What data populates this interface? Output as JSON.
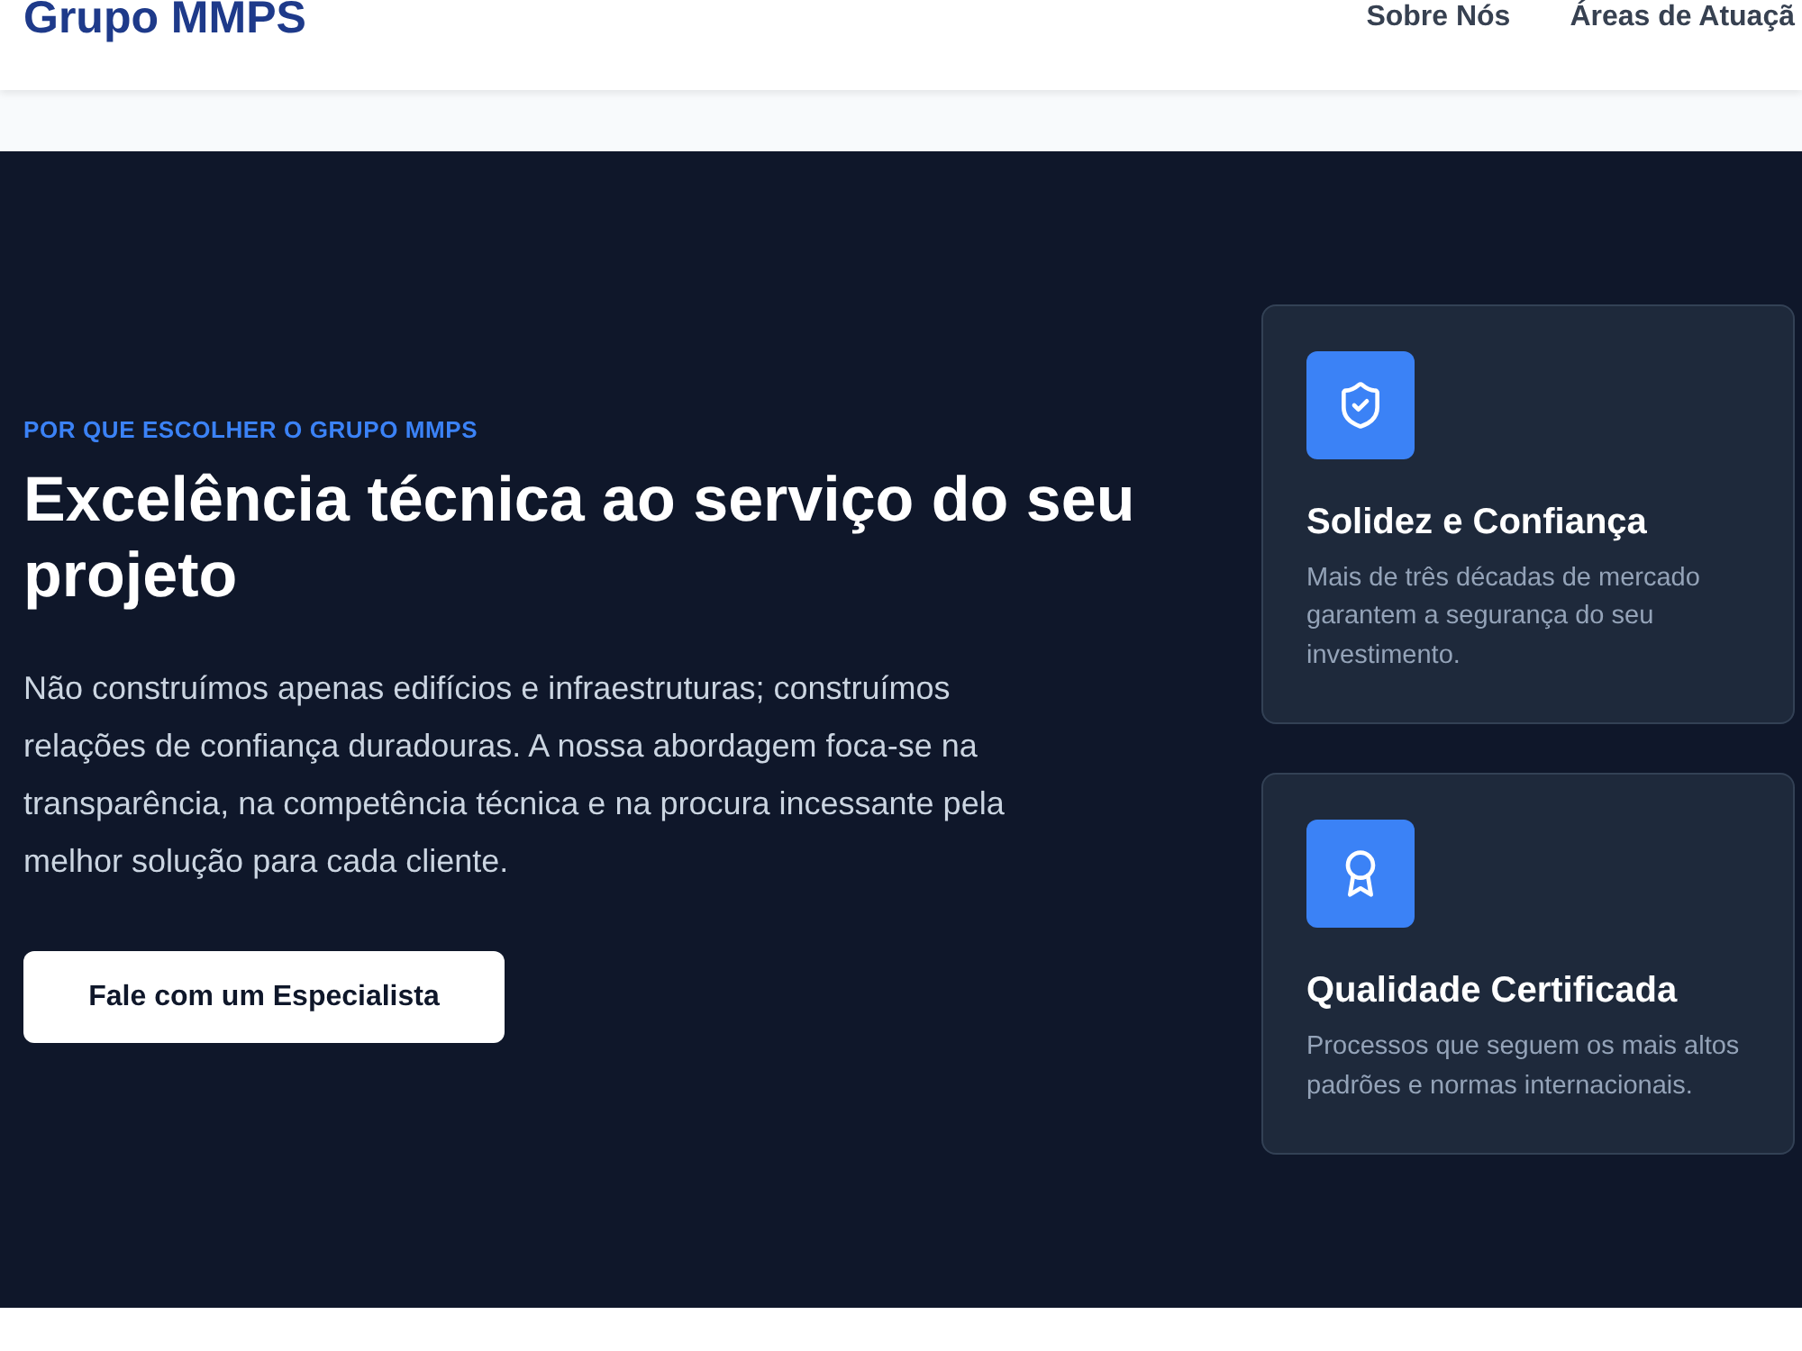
{
  "header": {
    "logo": "Grupo MMPS",
    "nav": [
      "Sobre Nós",
      "Áreas de Atuaçã"
    ]
  },
  "hero": {
    "eyebrow": "POR QUE ESCOLHER O GRUPO MMPS",
    "title": "Excelência técnica ao serviço do seu projeto",
    "paragraph": "Não construímos apenas edifícios e infraestruturas; construímos relações de confiança duradouras. A nossa abordagem foca-se na transparência, na competência técnica e na procura incessante pela melhor solução para cada cliente.",
    "button": "Fale com um Especialista"
  },
  "features": [
    {
      "kind": "shield",
      "title": "Solidez e Confiança",
      "description": "Mais de três décadas de mercado garantem a segurança do seu investimento."
    },
    {
      "kind": "award",
      "title": "Qualidade Certificada",
      "description": "Processos que seguem os mais altos padrões e normas internacionais."
    }
  ]
}
